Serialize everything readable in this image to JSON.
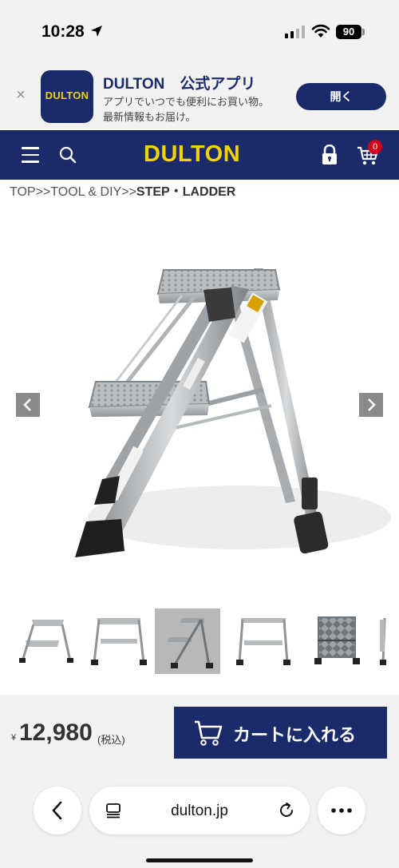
{
  "status_bar": {
    "time": "10:28",
    "battery": "90",
    "icons": [
      "location-arrow-icon",
      "signal-icon",
      "wifi-icon",
      "battery-icon"
    ]
  },
  "app_banner": {
    "close_glyph": "×",
    "app_icon_text": "DULTON",
    "title": "DULTON　公式アプリ",
    "desc_line1": "アプリでいつでも便利にお買い物。",
    "desc_line2": "最新情報もお届け。",
    "open_label": "開く"
  },
  "header": {
    "logo": "DULTON",
    "cart_count": "0",
    "icons": [
      "menu-icon",
      "search-icon",
      "lock-icon",
      "cart-icon"
    ]
  },
  "breadcrumb": {
    "items": [
      "TOP",
      "TOOL & DIY",
      "STEP・LADDER"
    ],
    "separator": ">>"
  },
  "gallery": {
    "active_index": 2,
    "thumbnail_count": 6
  },
  "purchase": {
    "currency_symbol": "¥",
    "price": "12,980",
    "tax_note": "(税込)",
    "add_to_cart_label": "カートに入れる"
  },
  "browser": {
    "url": "dulton.jp"
  },
  "colors": {
    "brand_navy": "#1b2a6b",
    "brand_yellow": "#f2d200",
    "badge_red": "#d0021b"
  }
}
